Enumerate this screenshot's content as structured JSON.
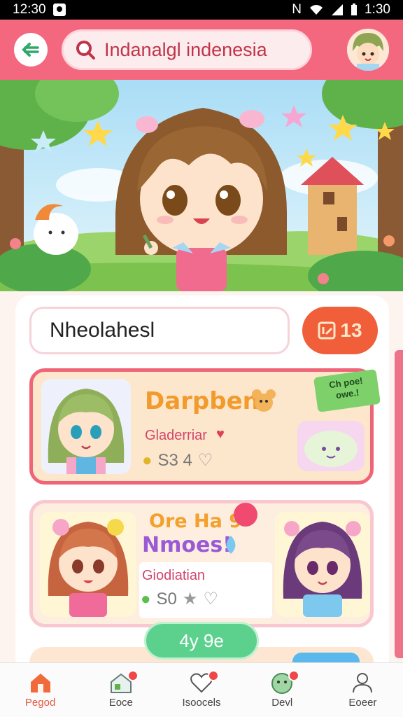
{
  "status_bar": {
    "time_left": "12:30",
    "time_right": "1:30"
  },
  "header": {
    "search_text": "Indanalgl indenesia"
  },
  "composer": {
    "title_value": "Nheolahesl",
    "action_label": "13"
  },
  "cards": [
    {
      "title": "Darpben",
      "sub": "Gladerriar",
      "stats": "S3 4",
      "badge_line1": "Ch poe!",
      "badge_line2": "owe.!"
    },
    {
      "title_line1": "Ore Ha 9",
      "title_line2": "Nmoes!",
      "sub": "Giodiatian",
      "stats": "S0"
    }
  ],
  "fab": {
    "label": "4y 9e"
  },
  "nav": [
    {
      "label": "Pegod",
      "active": true
    },
    {
      "label": "Eoce"
    },
    {
      "label": "Isoocels"
    },
    {
      "label": "Devl"
    },
    {
      "label": "Eoeer"
    }
  ],
  "colors": {
    "primary": "#f4687f",
    "accent": "#f05e3a",
    "fab": "#5cd18e",
    "card_border": "#f06478"
  }
}
